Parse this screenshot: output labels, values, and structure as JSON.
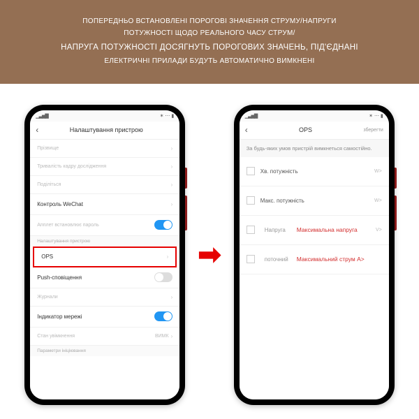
{
  "banner": {
    "line1": "ПОПЕРЕДНЬО ВСТАНОВЛЕНІ ПОРОГОВІ ЗНАЧЕННЯ СТРУМУ/НАПРУГИ",
    "line2": "ПОТУЖНОСТІ ЩОДО РЕАЛЬНОГО ЧАСУ СТРУМ/",
    "line3": "НАПРУГА ПОТУЖНОСТІ ДОСЯГНУТЬ ПОРОГОВИХ ЗНАЧЕНЬ, ПІД'ЄДНАНІ",
    "line4": "ЕЛЕКТРИЧНІ ПРИЛАДИ БУДУТЬ АВТОМАТИЧНО ВИМКНЕНІ"
  },
  "left": {
    "title": "Налаштування пристрою",
    "rows": {
      "r1": "Прізвище",
      "r2": "Тривалість кадру дослідження",
      "r3": "Поділіться",
      "r4": "Контроль WeChat",
      "r5": "Апплет встановлює пароль",
      "sec": "Налаштування пристрою",
      "ops": "OPS",
      "push": "Push-сповіщення",
      "log": "Журнали",
      "net": "Індикатор мережі",
      "power": "Стан увімкнення",
      "power_val": "ВИМК",
      "params": "Параметри ініціювання"
    }
  },
  "right": {
    "title": "OPS",
    "action": "зберегти",
    "sub": "За будь-яких умов пристрій вимкнеться самостійно.",
    "r1": "Хв. потужність",
    "u1": "W>",
    "r2": "Макс. потужність",
    "u2": "W>",
    "r3l": "Напруга",
    "r3r": "Максимальна напруга",
    "u3": "V>",
    "r4l": "поточний",
    "r4r": "Максимальний струм A>"
  }
}
